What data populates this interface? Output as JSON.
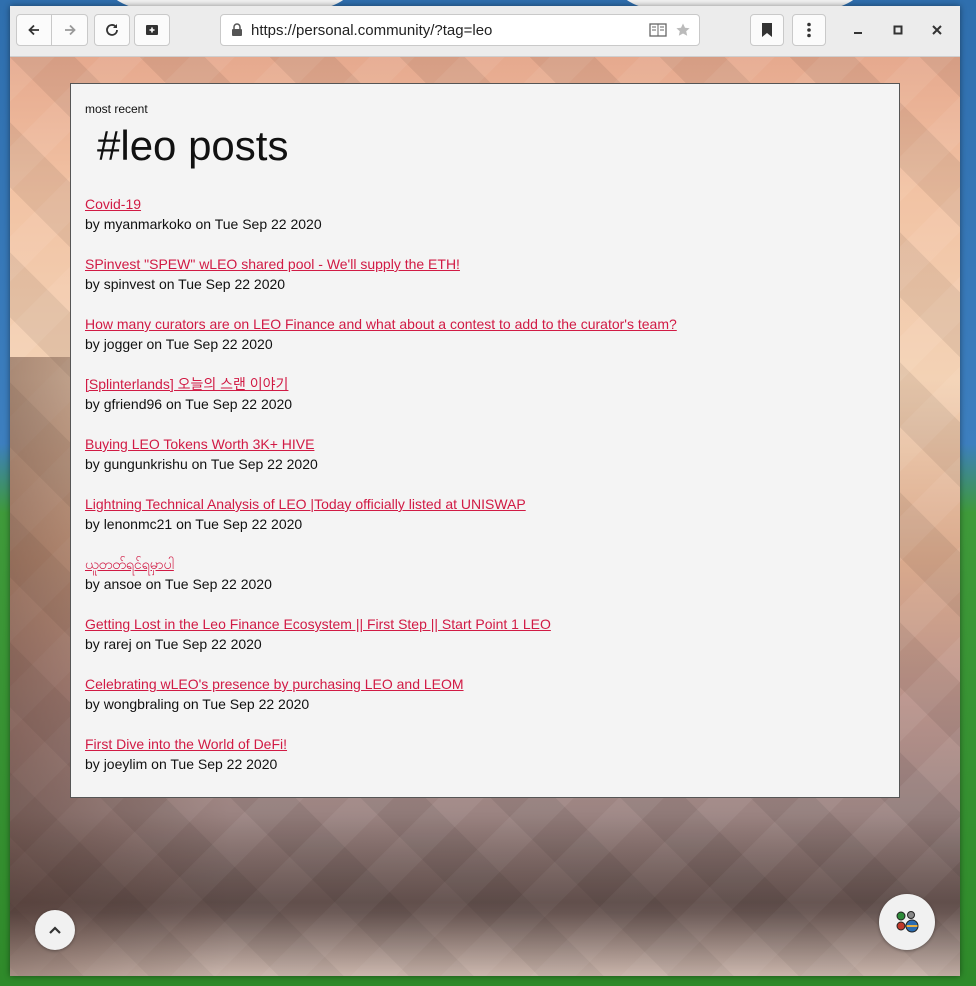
{
  "browser": {
    "url": "https://personal.community/?tag=leo"
  },
  "page": {
    "subtitle": "most recent",
    "title": "#leo posts",
    "by_word": "by",
    "on_word": "on"
  },
  "posts": [
    {
      "title": "Covid-19",
      "author": "myanmarkoko",
      "date": "Tue Sep 22 2020"
    },
    {
      "title": "SPinvest \"SPEW\" wLEO shared pool - We'll supply the ETH!",
      "author": "spinvest",
      "date": "Tue Sep 22 2020"
    },
    {
      "title": "How many curators are on LEO Finance and what about a contest to add to the curator's team?",
      "author": "jogger",
      "date": "Tue Sep 22 2020"
    },
    {
      "title": "[Splinterlands] 오늘의 스랜 이야기",
      "author": "gfriend96",
      "date": "Tue Sep 22 2020"
    },
    {
      "title": "Buying LEO Tokens Worth 3K+ HIVE",
      "author": "gungunkrishu",
      "date": "Tue Sep 22 2020"
    },
    {
      "title": "Lightning Technical Analysis of LEO |Today officially listed at UNISWAP",
      "author": "lenonmc21",
      "date": "Tue Sep 22 2020"
    },
    {
      "title": "ယူတတ်ရင်ရမှာပါ",
      "author": "ansoe",
      "date": "Tue Sep 22 2020"
    },
    {
      "title": "Getting Lost in the Leo Finance Ecosystem || First Step || Start Point 1 LEO",
      "author": "rarej",
      "date": "Tue Sep 22 2020"
    },
    {
      "title": "Celebrating wLEO's presence by purchasing LEO and LEOM",
      "author": "wongbraling",
      "date": "Tue Sep 22 2020"
    },
    {
      "title": "First Dive into the World of DeFi!",
      "author": "joeylim",
      "date": "Tue Sep 22 2020"
    }
  ],
  "colors": {
    "link": "#d11a44",
    "card_bg": "#f4f4f4"
  },
  "icons": {
    "back": "arrow-left-icon",
    "forward": "arrow-right-icon",
    "reload": "reload-icon",
    "new_tab": "add-tab-icon",
    "lock": "lock-icon",
    "reader": "reader-mode-icon",
    "star": "star-icon",
    "bookmarks": "bookmark-icon",
    "menu": "kebab-menu-icon",
    "minimize": "minimize-icon",
    "maximize": "maximize-icon",
    "close": "close-icon",
    "scroll_top": "chevron-up-icon",
    "app": "app-logo-icon"
  }
}
